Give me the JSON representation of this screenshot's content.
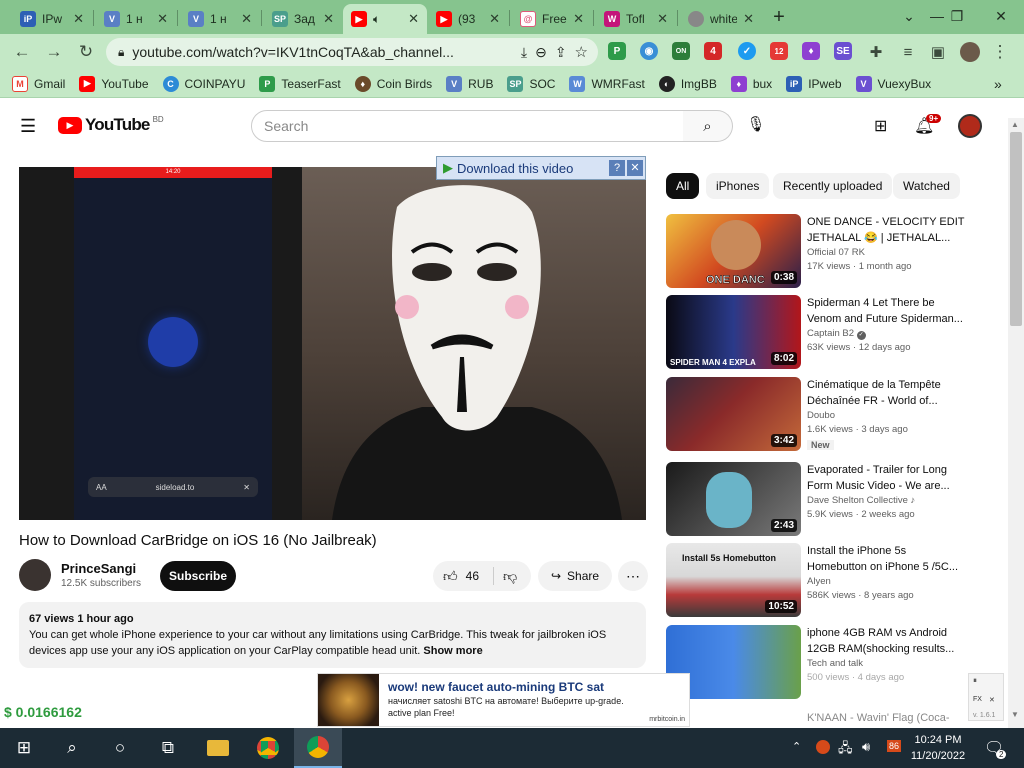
{
  "browser": {
    "tabs": [
      {
        "title": "IPw",
        "icon": "ipweb-icon",
        "color": "#2d5fb5"
      },
      {
        "title": "1 н",
        "icon": "vuexy-icon",
        "color": "#5a7fc5"
      },
      {
        "title": "1 н",
        "icon": "vuexy-icon",
        "color": "#5a7fc5"
      },
      {
        "title": "Зад",
        "icon": "sp-icon",
        "color": "#4a9e8c"
      },
      {
        "title": "",
        "icon": "youtube-icon",
        "color": "#ff0000",
        "active": true
      },
      {
        "title": "(93",
        "icon": "youtube-icon",
        "color": "#ff0000"
      },
      {
        "title": "Free",
        "icon": "faucet-icon",
        "color": "#e05a7a"
      },
      {
        "title": "Tofl",
        "icon": "tofl-icon",
        "color": "#c4157a"
      },
      {
        "title": "whitebi",
        "icon": "globe-icon",
        "color": "#777777"
      }
    ],
    "new_tab": "+",
    "url": "youtube.com/watch?v=IKV1tnCoqTA&ab_channel...",
    "bookmarks": [
      {
        "label": "Gmail",
        "icon": "gmail-icon",
        "color": "#ea4335"
      },
      {
        "label": "YouTube",
        "icon": "youtube-icon",
        "color": "#ff0000"
      },
      {
        "label": "COINPAYU",
        "icon": "coinpayu-icon",
        "color": "#2d8bd6"
      },
      {
        "label": "TeaserFast",
        "icon": "teaserfast-icon",
        "color": "#2e9b4a"
      },
      {
        "label": "Coin Birds",
        "icon": "coinbirds-icon",
        "color": "#6a4a2a"
      },
      {
        "label": "RUB",
        "icon": "vuexy-icon",
        "color": "#5a7fc5"
      },
      {
        "label": "SOC",
        "icon": "sp-icon",
        "color": "#4a9e8c"
      },
      {
        "label": "WMRFast",
        "icon": "wmrfast-icon",
        "color": "#5a8ad6"
      },
      {
        "label": "ImgBB",
        "icon": "imgbb-icon",
        "color": "#222222"
      },
      {
        "label": "bux",
        "icon": "bux-icon",
        "color": "#8e3fd1"
      },
      {
        "label": "IPweb",
        "icon": "ipweb-icon",
        "color": "#2d5fb5"
      },
      {
        "label": "VuexyBux",
        "icon": "vuexy-icon",
        "color": "#6b4fd1"
      }
    ],
    "ext_badges": {
      "on": "ON",
      "count4": "4",
      "count12": "12"
    }
  },
  "youtube": {
    "logo_text": "YouTube",
    "region": "BD",
    "search_placeholder": "Search",
    "notification_count": "9+",
    "download_bar": "Download this video",
    "video": {
      "title": "How to Download CarBridge on iOS 16 (No Jailbreak)",
      "channel": "PrinceSangi",
      "subscribers": "12.5K subscribers",
      "subscribe_label": "Subscribe",
      "likes": "46",
      "share_label": "Share",
      "phone_url": "sideload.to",
      "phone_aa": "AA",
      "phone_time": "14:20",
      "description": {
        "meta": "67 views  1 hour ago",
        "text": "You can get whole iPhone experience to your car without any limitations using CarBridge. This tweak for jailbroken iOS devices app use your any iOS application on your CarPlay compatible head unit.",
        "show_more": "Show more"
      }
    },
    "chips": [
      {
        "label": "All",
        "selected": true
      },
      {
        "label": "iPhones"
      },
      {
        "label": "Recently uploaded"
      },
      {
        "label": "Watched"
      }
    ],
    "recommendations": [
      {
        "title": "ONE DANCE - VELOCITY EDIT JETHALAL 😂 | JETHALAL...",
        "channel": "Official 07 RK",
        "meta": "17K views  ·  1 month ago",
        "duration": "0:38"
      },
      {
        "title": "Spiderman 4 Let There be Venom and Future Spiderman...",
        "channel": "Captain B2",
        "meta": "63K views  ·  12 days ago",
        "duration": "8:02"
      },
      {
        "title": "Cinématique de la Tempête Déchaînée FR - World of...",
        "channel": "Doubo",
        "meta": "1.6K views  ·  3 days ago",
        "badge": "New",
        "duration": "3:42"
      },
      {
        "title": "Evaporated - Trailer for Long Form Music Video - We are...",
        "channel": "Dave Shelton Collective ♪",
        "meta": "5.9K views  ·  2 weeks ago",
        "duration": "2:43"
      },
      {
        "title": "Install the iPhone 5s Homebutton on iPhone 5 /5C...",
        "channel": "Alyen",
        "meta": "586K views  ·  8 years ago",
        "duration": "10:52",
        "thumb_text": "Install 5s Homebutton"
      },
      {
        "title": "iphone 4GB RAM vs Android 12GB RAM(shocking results...",
        "channel": "Tech and talk",
        "meta": "500 views  ·  4 days ago",
        "duration": ""
      },
      {
        "title": "K'NAAN - Wavin' Flag (Coca-",
        "channel": "",
        "meta": "",
        "duration": ""
      }
    ],
    "thumb_texts": {
      "one_dance": "ONE DANC",
      "spiderman": "SPIDER MAN 4 EXPLA"
    }
  },
  "overlay": {
    "balance": "$ 0.0166162",
    "ad": {
      "title": "wow! new faucet auto-mining BTC sat",
      "text": "начисляет satoshi BTC на автомате! Выберите up-grade. active plan Free!",
      "source": "mrbitcoin.in"
    },
    "side_widget": {
      "version": "v. 1.6.1",
      "pause": "⏸",
      "fx": "FX",
      "close": "✕"
    }
  },
  "taskbar": {
    "time": "10:24 PM",
    "date": "11/20/2022",
    "notif_count": "2",
    "tray_badge": "86"
  },
  "colors": {
    "youtube_red": "#ff0000",
    "tab_green": "#86c48e",
    "toolbar_green": "#c4e8c6",
    "taskbar": "#1c2b35"
  }
}
